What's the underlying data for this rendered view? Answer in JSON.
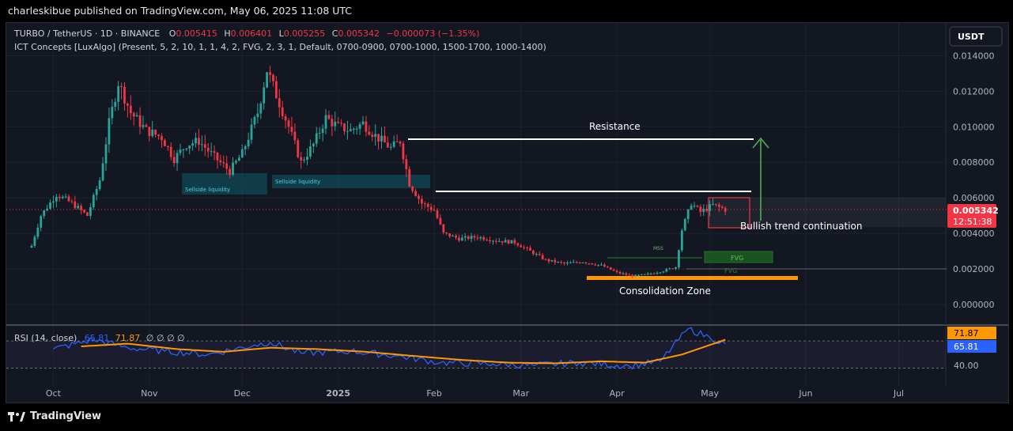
{
  "header": {
    "published": "charleskibue published on TradingView.com, May 06, 2025 11:08 UTC"
  },
  "footer": {
    "brand": "TradingView"
  },
  "legend": {
    "symbol": "TURBO / TetherUS · 1D · BINANCE",
    "open_label": "O",
    "open": "0.005415",
    "high_label": "H",
    "high": "0.006401",
    "low_label": "L",
    "low": "0.005255",
    "close_label": "C",
    "close": "0.005342",
    "change": "−0.000073 (−1.35%)",
    "indicator": "ICT Concepts [LuxAlgo] (Present, 5, 2, 10, 1, 1, 4, 2, FVG, 2, 3, 1, Default, 0700-0900, 0700-1000, 1500-1700, 1000-1400)"
  },
  "currency_button": "USDT",
  "price_axis": {
    "ticks": [
      "0.014000",
      "0.012000",
      "0.010000",
      "0.008000",
      "0.006000",
      "0.004000",
      "0.002000",
      "0.000000"
    ],
    "current_price": "0.005342",
    "countdown": "12:51:38"
  },
  "time_axis": {
    "ticks": [
      "Oct",
      "Nov",
      "Dec",
      "2025",
      "Feb",
      "Mar",
      "Apr",
      "May",
      "Jun",
      "Jul"
    ]
  },
  "annotations": {
    "resistance": "Resistance",
    "bullish": "Bullish trend continuation",
    "consolidation": "Consolidation Zone",
    "sellside1": "Sellside liquidity",
    "sellside2": "Sellside liquidity",
    "mss": "MSS",
    "fvg1": "FVG",
    "fvg2": "FVG"
  },
  "rsi": {
    "label": "RSI (14, close)",
    "value": "65.81",
    "ma_value": "71.87",
    "extras": "∅ ∅ ∅ ∅",
    "axis_tick": "40.00"
  },
  "colors": {
    "up": "#26a69a",
    "down": "#f23645",
    "rsi": "#2962ff",
    "rsi_ma": "#ff9800",
    "zone": "#ff9800",
    "arrow": "#4caf50"
  },
  "chart_data": {
    "type": "candlestick",
    "interval": "1D",
    "ylim": [
      0,
      0.0148
    ],
    "x_start": "2024-09-24",
    "x_end": "2025-05-06",
    "close_points": [
      [
        "2024-09-24",
        0.0033
      ],
      [
        "2024-09-27",
        0.005
      ],
      [
        "2024-10-02",
        0.0062
      ],
      [
        "2024-10-07",
        0.0057
      ],
      [
        "2024-10-12",
        0.005
      ],
      [
        "2024-10-16",
        0.007
      ],
      [
        "2024-10-19",
        0.0102
      ],
      [
        "2024-10-22",
        0.0125
      ],
      [
        "2024-10-26",
        0.0108
      ],
      [
        "2024-10-31",
        0.0098
      ],
      [
        "2024-11-05",
        0.0094
      ],
      [
        "2024-11-09",
        0.0082
      ],
      [
        "2024-11-13",
        0.009
      ],
      [
        "2024-11-17",
        0.0092
      ],
      [
        "2024-11-22",
        0.0083
      ],
      [
        "2024-11-27",
        0.0075
      ],
      [
        "2024-12-01",
        0.0085
      ],
      [
        "2024-12-06",
        0.0108
      ],
      [
        "2024-12-09",
        0.0132
      ],
      [
        "2024-12-12",
        0.0118
      ],
      [
        "2024-12-16",
        0.01
      ],
      [
        "2024-12-20",
        0.008
      ],
      [
        "2024-12-24",
        0.009
      ],
      [
        "2024-12-28",
        0.0105
      ],
      [
        "2025-01-01",
        0.01
      ],
      [
        "2025-01-05",
        0.0098
      ],
      [
        "2025-01-09",
        0.0102
      ],
      [
        "2025-01-13",
        0.0095
      ],
      [
        "2025-01-18",
        0.0088
      ],
      [
        "2025-01-21",
        0.0092
      ],
      [
        "2025-01-24",
        0.0068
      ],
      [
        "2025-01-28",
        0.0057
      ],
      [
        "2025-02-01",
        0.0053
      ],
      [
        "2025-02-04",
        0.004
      ],
      [
        "2025-02-09",
        0.0037
      ],
      [
        "2025-02-15",
        0.0038
      ],
      [
        "2025-02-21",
        0.0036
      ],
      [
        "2025-02-27",
        0.0035
      ],
      [
        "2025-03-04",
        0.003
      ],
      [
        "2025-03-09",
        0.0025
      ],
      [
        "2025-03-15",
        0.0023
      ],
      [
        "2025-03-21",
        0.0024
      ],
      [
        "2025-03-27",
        0.0022
      ],
      [
        "2025-04-01",
        0.0018
      ],
      [
        "2025-04-06",
        0.0016
      ],
      [
        "2025-04-11",
        0.0017
      ],
      [
        "2025-04-16",
        0.0019
      ],
      [
        "2025-04-20",
        0.0021
      ],
      [
        "2025-04-22",
        0.0042
      ],
      [
        "2025-04-25",
        0.0057
      ],
      [
        "2025-04-28",
        0.0052
      ],
      [
        "2025-05-02",
        0.0056
      ],
      [
        "2025-05-06",
        0.005342
      ]
    ],
    "levels": {
      "resistance": 0.0093,
      "support_line": 0.0064,
      "bullish_zone": [
        0.0045,
        0.006
      ],
      "consolidation": [
        0.00135,
        0.00155
      ],
      "sellside_liquidity_1": [
        0.007,
        0.0079
      ],
      "sellside_liquidity_2": [
        0.0066,
        0.0073
      ],
      "fvg_1": [
        0.0024,
        0.003
      ],
      "fvg_2": 0.002,
      "mss": 0.0027,
      "target_arrow": [
        0.0047,
        0.0093
      ]
    },
    "rsi": {
      "ylim": [
        20,
        90
      ],
      "points": [
        [
          "2024-10-01",
          58
        ],
        [
          "2024-10-14",
          72
        ],
        [
          "2024-10-25",
          60
        ],
        [
          "2024-11-06",
          55
        ],
        [
          "2024-11-20",
          50
        ],
        [
          "2024-12-05",
          64
        ],
        [
          "2024-12-10",
          68
        ],
        [
          "2024-12-20",
          52
        ],
        [
          "2025-01-05",
          55
        ],
        [
          "2025-01-20",
          48
        ],
        [
          "2025-02-03",
          38
        ],
        [
          "2025-02-20",
          36
        ],
        [
          "2025-03-05",
          34
        ],
        [
          "2025-03-20",
          38
        ],
        [
          "2025-04-05",
          33
        ],
        [
          "2025-04-15",
          40
        ],
        [
          "2025-04-24",
          88
        ],
        [
          "2025-05-01",
          75
        ],
        [
          "2025-05-06",
          65.81
        ]
      ],
      "ma_points": [
        [
          "2024-10-10",
          62
        ],
        [
          "2024-10-25",
          66
        ],
        [
          "2024-11-10",
          58
        ],
        [
          "2024-11-25",
          54
        ],
        [
          "2024-12-10",
          60
        ],
        [
          "2024-12-25",
          58
        ],
        [
          "2025-01-10",
          54
        ],
        [
          "2025-01-25",
          48
        ],
        [
          "2025-02-10",
          42
        ],
        [
          "2025-02-25",
          38
        ],
        [
          "2025-03-12",
          37
        ],
        [
          "2025-03-27",
          40
        ],
        [
          "2025-04-10",
          38
        ],
        [
          "2025-04-22",
          50
        ],
        [
          "2025-05-06",
          71.87
        ]
      ]
    }
  }
}
